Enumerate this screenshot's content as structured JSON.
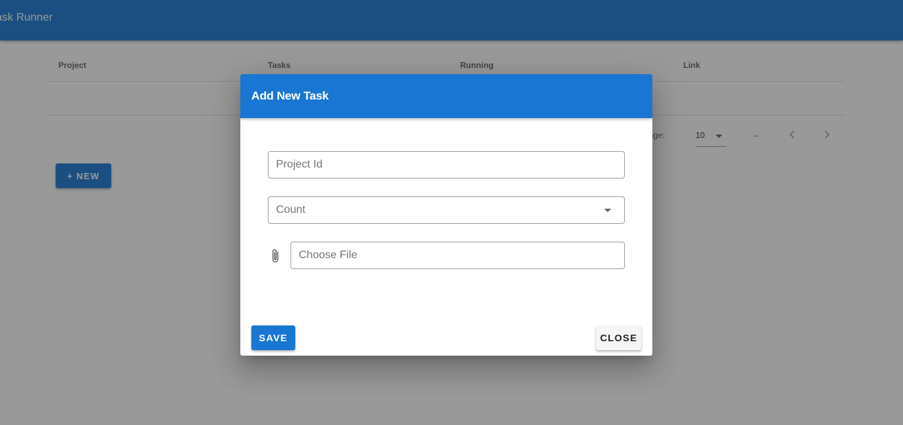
{
  "app": {
    "title": "ask Runner"
  },
  "table": {
    "columns": [
      "Project",
      "Tasks",
      "Running",
      "Link"
    ]
  },
  "pagination": {
    "label": "page:",
    "rows_per_page": "10",
    "range": "–"
  },
  "new_button": {
    "label": "+ NEW"
  },
  "dialog": {
    "title": "Add New Task",
    "fields": {
      "project_id_placeholder": "Project Id",
      "count_placeholder": "Count",
      "file_placeholder": "Choose File"
    },
    "save_label": "SAVE",
    "close_label": "CLOSE"
  },
  "icons": {
    "pager_prev": "chevron-left-icon",
    "pager_next": "chevron-right-icon",
    "select_caret": "caret-down-icon",
    "attach": "paperclip-icon"
  },
  "colors": {
    "primary": "#1976d2",
    "scrim": "rgba(33,33,33,0.46)"
  }
}
